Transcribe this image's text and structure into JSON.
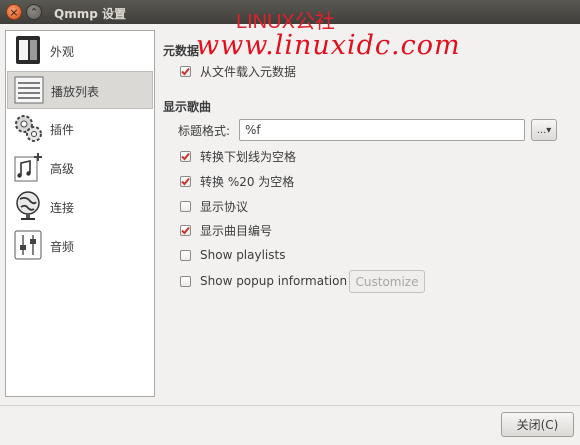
{
  "window": {
    "title": "Qmmp 设置",
    "close_glyph": "×",
    "minimize_glyph": "⌃"
  },
  "watermark": {
    "top": "LINUX公社",
    "url": "www.linuxidc.com"
  },
  "sidebar": {
    "items": [
      {
        "label": "外观",
        "icon": "appearance-icon",
        "selected": false
      },
      {
        "label": "播放列表",
        "icon": "playlist-icon",
        "selected": true
      },
      {
        "label": "插件",
        "icon": "plugins-icon",
        "selected": false
      },
      {
        "label": "高级",
        "icon": "advanced-icon",
        "selected": false
      },
      {
        "label": "连接",
        "icon": "connection-icon",
        "selected": false
      },
      {
        "label": "音频",
        "icon": "audio-icon",
        "selected": false
      }
    ]
  },
  "metadata": {
    "title": "元数据",
    "load_metadata": {
      "label": "从文件载入元数据",
      "checked": true
    }
  },
  "song_display": {
    "title": "显示歌曲",
    "title_format_label": "标题格式:",
    "title_format_value": "%f",
    "format_button": "...▾",
    "options": [
      {
        "label": "转换下划线为空格",
        "checked": true
      },
      {
        "label": "转换 %20 为空格",
        "checked": true
      },
      {
        "label": "显示协议",
        "checked": false
      },
      {
        "label": "显示曲目编号",
        "checked": true
      },
      {
        "label": "Show playlists",
        "checked": false
      },
      {
        "label": "Show popup information",
        "checked": false
      }
    ],
    "customize_button": "Customize"
  },
  "footer": {
    "close_button": "关闭(C)"
  },
  "colors": {
    "accent_check": "#c9352f",
    "watermark_red": "#e0101e",
    "titlebar": "#3f3e3a"
  }
}
